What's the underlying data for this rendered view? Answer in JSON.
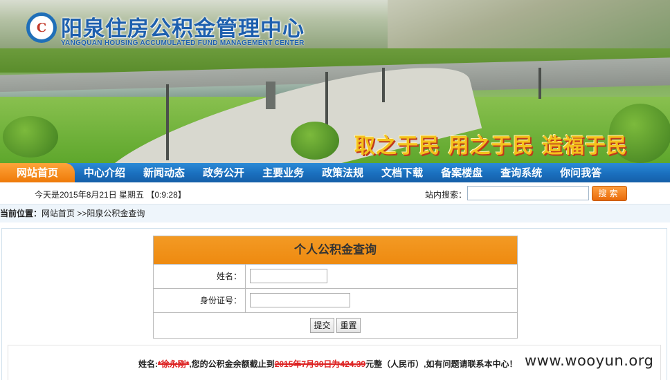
{
  "header": {
    "logo_glyph": "C",
    "title": "阳泉住房公积金管理中心",
    "subtitle": "YANGQUAN HOUSING ACCUMULATED FUND MANAGEMENT CENTER",
    "slogan": "取之于民  用之于民  造福于民"
  },
  "nav": {
    "items": [
      {
        "label": "网站首页",
        "active": true
      },
      {
        "label": "中心介绍"
      },
      {
        "label": "新闻动态"
      },
      {
        "label": "政务公开"
      },
      {
        "label": "主要业务"
      },
      {
        "label": "政策法规"
      },
      {
        "label": "文档下载"
      },
      {
        "label": "备案楼盘"
      },
      {
        "label": "查询系统"
      },
      {
        "label": "你问我答"
      }
    ]
  },
  "infobar": {
    "date": "今天是2015年8月21日 星期五 【0:9:28】",
    "search_label": "站内搜索：",
    "search_value": "",
    "search_button": "搜索"
  },
  "breadcrumb": {
    "prefix": "当前位置：",
    "path": "网站首页 >>阳泉公积金查询"
  },
  "form": {
    "title": "个人公积金查询",
    "name_label": "姓名：",
    "name_value": "",
    "id_label": "身份证号：",
    "id_value": "",
    "submit": "提交",
    "reset": "重置"
  },
  "result": {
    "part1": "姓名:",
    "name": "*徐永刚*",
    "part2": ",您的公积金余额截止到",
    "date": "2015年7月30日为",
    "amount": "424.39",
    "part3": "元整（人民币）,如有问题请联系本中心！"
  },
  "watermark": "www.wooyun.org",
  "colors": {
    "nav_blue": "#1a6fbe",
    "accent_orange": "#ee8a10",
    "title_blue": "#1d5fae",
    "redaction_red": "#d22"
  }
}
